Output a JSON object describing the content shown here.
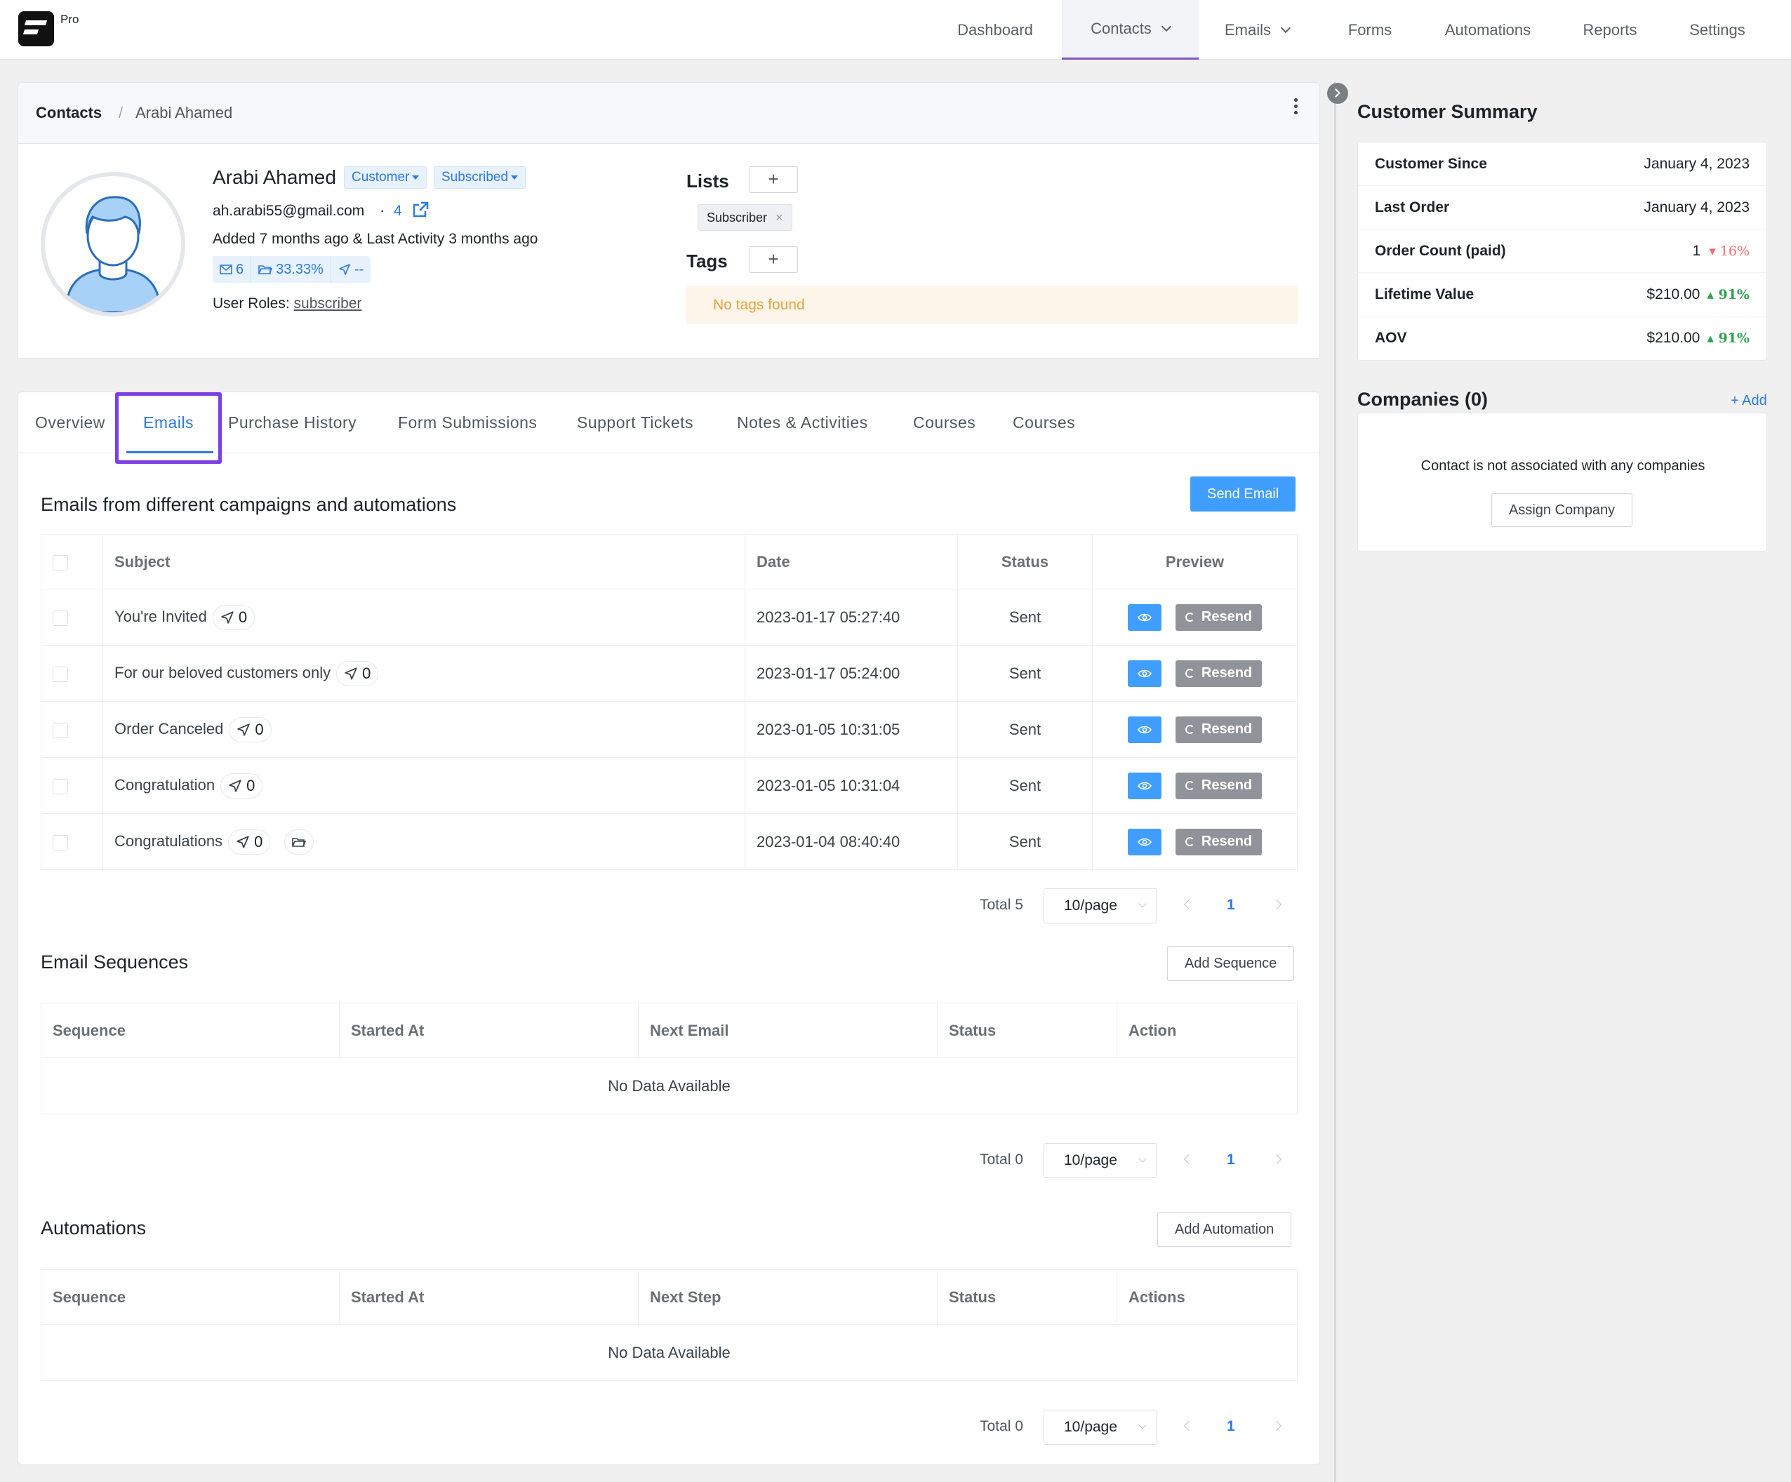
{
  "app": {
    "badge": "Pro"
  },
  "nav": {
    "dashboard": "Dashboard",
    "contacts": "Contacts",
    "emails": "Emails",
    "forms": "Forms",
    "automations": "Automations",
    "reports": "Reports",
    "settings": "Settings"
  },
  "breadcrumb": {
    "root": "Contacts",
    "sep": "/",
    "current": "Arabi Ahamed"
  },
  "contact": {
    "name": "Arabi Ahamed",
    "type_badge": "Customer",
    "status_badge": "Subscribed",
    "email": "ah.arabi55@gmail.com",
    "dot": "·",
    "linked_count": "4",
    "activity": "Added 7 months ago & Last Activity 3 months ago",
    "stat_emails": "6",
    "stat_open_rate": "33.33%",
    "stat_click": "--",
    "roles_label": "User Roles:",
    "roles_value": "subscriber"
  },
  "lists": {
    "title": "Lists",
    "add": "+",
    "items": [
      "Subscriber"
    ],
    "remove": "×"
  },
  "tags": {
    "title": "Tags",
    "add": "+",
    "empty": "No tags found"
  },
  "tabs": [
    "Overview",
    "Emails",
    "Purchase History",
    "Form Submissions",
    "Support Tickets",
    "Notes & Activities",
    "Courses",
    "Courses"
  ],
  "emails_section": {
    "title": "Emails from different campaigns and automations",
    "send_button": "Send Email",
    "columns": {
      "subject": "Subject",
      "date": "Date",
      "status": "Status",
      "preview": "Preview"
    },
    "rows": [
      {
        "subject": "You're Invited",
        "clicks": "0",
        "date": "2023-01-17 05:27:40",
        "status": "Sent",
        "resend": "Resend"
      },
      {
        "subject": "For our beloved customers only",
        "clicks": "0",
        "date": "2023-01-17 05:24:00",
        "status": "Sent",
        "resend": "Resend"
      },
      {
        "subject": "Order Canceled",
        "clicks": "0",
        "date": "2023-01-05 10:31:05",
        "status": "Sent",
        "resend": "Resend"
      },
      {
        "subject": "Congratulation",
        "clicks": "0",
        "date": "2023-01-05 10:31:04",
        "status": "Sent",
        "resend": "Resend"
      },
      {
        "subject": "Congratulations",
        "clicks": "0",
        "date": "2023-01-04 08:40:40",
        "status": "Sent",
        "resend": "Resend"
      }
    ],
    "pager": {
      "total": "Total 5",
      "size": "10/page",
      "page": "1"
    }
  },
  "sequences_section": {
    "title": "Email Sequences",
    "add_button": "Add Sequence",
    "columns": {
      "sequence": "Sequence",
      "started": "Started At",
      "next": "Next Email",
      "status": "Status",
      "action": "Action"
    },
    "empty": "No Data Available",
    "pager": {
      "total": "Total 0",
      "size": "10/page",
      "page": "1"
    }
  },
  "automations_section": {
    "title": "Automations",
    "add_button": "Add Automation",
    "columns": {
      "sequence": "Sequence",
      "started": "Started At",
      "next": "Next Step",
      "status": "Status",
      "action": "Actions"
    },
    "empty": "No Data Available",
    "pager": {
      "total": "Total 0",
      "size": "10/page",
      "page": "1"
    }
  },
  "summary": {
    "title": "Customer Summary",
    "since_label": "Customer Since",
    "since_value": "January 4, 2023",
    "last_order_label": "Last Order",
    "last_order_value": "January 4, 2023",
    "order_count_label": "Order Count (paid)",
    "order_count_value": "1",
    "order_count_change": "▾ 16%",
    "ltv_label": "Lifetime Value",
    "ltv_value": "$210.00",
    "ltv_change": "▴ 91%",
    "aov_label": "AOV",
    "aov_value": "$210.00",
    "aov_change": "▴ 91%"
  },
  "companies": {
    "title": "Companies (0)",
    "add_link": "+ Add",
    "empty": "Contact is not associated with any companies",
    "assign_button": "Assign Company"
  },
  "colors": {
    "accent": "#2b7be0",
    "primary_button": "#409eff",
    "highlight": "#7b3fe4",
    "up": "#30a14e",
    "down": "#f56c6c"
  }
}
